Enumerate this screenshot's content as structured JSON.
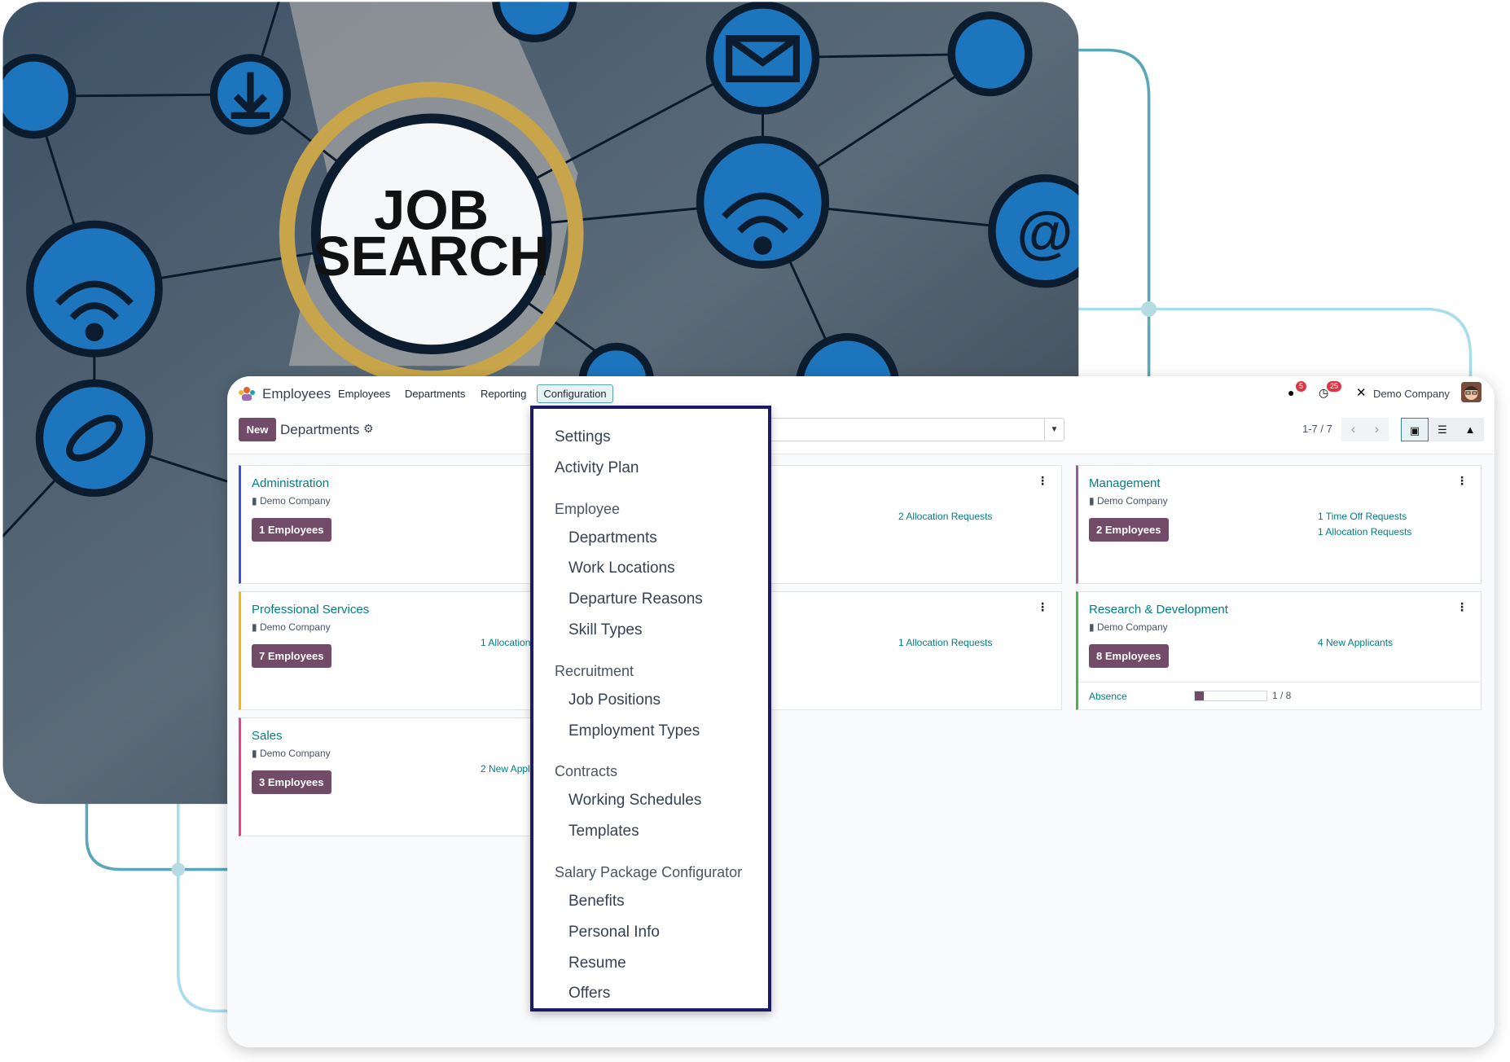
{
  "hero": {
    "headline_1": "JOB",
    "headline_2": "SEARCH"
  },
  "navbar": {
    "app_name": "Employees",
    "menu": [
      "Employees",
      "Departments",
      "Reporting",
      "Configuration"
    ],
    "messages_count": "5",
    "activities_count": "25",
    "company": "Demo Company"
  },
  "control": {
    "new_label": "New",
    "title": "Departments",
    "pager": "1-7 / 7"
  },
  "colors": {
    "accent": "#017e84",
    "primary": "#714b67",
    "dropdown_border": "#1c1a6b"
  },
  "cards": [
    {
      "name": "Administration",
      "company": "Demo Company",
      "employees": "1 Employees",
      "links": [],
      "color": "#3b4fe0",
      "col": 0,
      "row": 0
    },
    {
      "name": "",
      "company": "",
      "employees": "",
      "links": [
        "2 Allocation Requests"
      ],
      "color": "#e2e4e8",
      "col": 1,
      "row": 0
    },
    {
      "name": "Management",
      "company": "Demo Company",
      "employees": "2 Employees",
      "links": [
        "1 Time Off Requests",
        "1 Allocation Requests"
      ],
      "color": "#9b5a96",
      "col": 2,
      "row": 0
    },
    {
      "name": "Professional Services",
      "company": "Demo Company",
      "employees": "7 Employees",
      "links": [
        "1 Allocation Requests"
      ],
      "color": "#f0b90b",
      "col": 0,
      "row": 1
    },
    {
      "name": "",
      "company": "",
      "employees": "",
      "links": [
        "1 Allocation Requests"
      ],
      "color": "#e2e4e8",
      "col": 1,
      "row": 1
    },
    {
      "name": "Research & Development",
      "company": "Demo Company",
      "employees": "8 Employees",
      "links": [
        "4 New Applicants"
      ],
      "color": "#4caf50",
      "col": 2,
      "row": 1,
      "absence": {
        "label": "Absence",
        "value": 1,
        "max": 8,
        "text": "1 / 8"
      }
    },
    {
      "name": "Sales",
      "company": "Demo Company",
      "employees": "3 Employees",
      "links": [
        "2 New Applicants"
      ],
      "color": "#e83e8c",
      "col": 0,
      "row": 2
    }
  ],
  "config_menu": [
    {
      "type": "top",
      "label": "Settings"
    },
    {
      "type": "top",
      "label": "Activity Plan"
    },
    {
      "type": "header",
      "label": "Employee"
    },
    {
      "type": "item",
      "label": "Departments"
    },
    {
      "type": "item",
      "label": "Work Locations"
    },
    {
      "type": "item",
      "label": "Departure Reasons"
    },
    {
      "type": "item",
      "label": "Skill Types"
    },
    {
      "type": "header",
      "label": "Recruitment"
    },
    {
      "type": "item",
      "label": "Job Positions"
    },
    {
      "type": "item",
      "label": "Employment Types"
    },
    {
      "type": "header",
      "label": "Contracts"
    },
    {
      "type": "item",
      "label": "Working Schedules"
    },
    {
      "type": "item",
      "label": "Templates"
    },
    {
      "type": "header",
      "label": "Salary Package Configurator"
    },
    {
      "type": "item",
      "label": "Benefits"
    },
    {
      "type": "item",
      "label": "Personal Info"
    },
    {
      "type": "item",
      "label": "Resume"
    },
    {
      "type": "item",
      "label": "Offers"
    }
  ]
}
